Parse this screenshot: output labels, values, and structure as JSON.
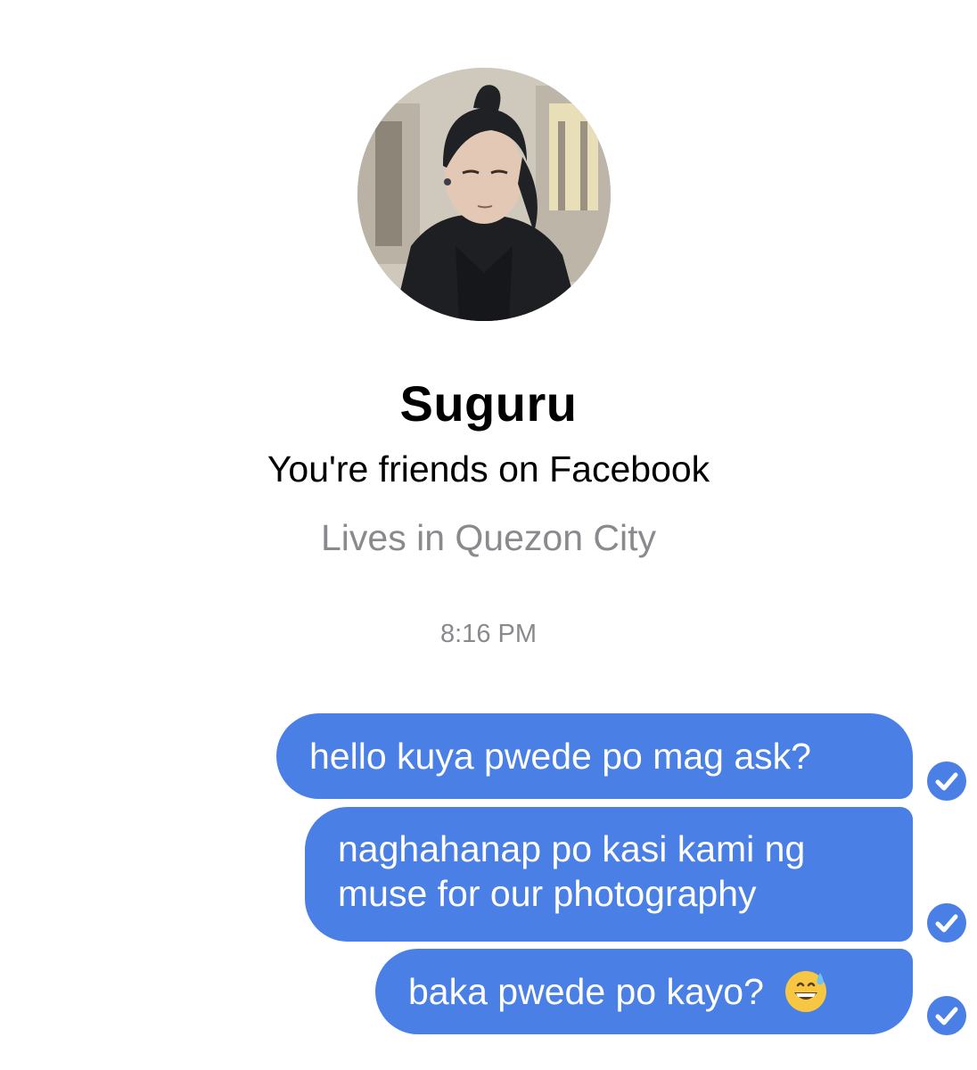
{
  "profile": {
    "name": "Suguru",
    "friend_status": "You're friends on Facebook",
    "location": "Lives in Quezon City"
  },
  "conversation": {
    "timestamp": "8:16 PM",
    "messages": [
      {
        "text": "hello kuya pwede po mag ask?",
        "status": "seen"
      },
      {
        "lines": [
          "naghahanap po kasi kami ng",
          "muse for our photography"
        ],
        "status": "seen"
      },
      {
        "text": "baka pwede po kayo?",
        "emoji": "grinning-face-with-sweat",
        "status": "seen"
      }
    ]
  },
  "colors": {
    "bubble": "#4a7fe6",
    "muted_text": "#8a8a8e"
  }
}
